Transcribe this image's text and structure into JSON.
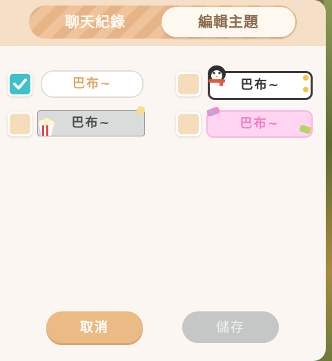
{
  "tabs": {
    "history": "聊天紀錄",
    "edit_theme": "編輯主題"
  },
  "themes": [
    {
      "label": "巴布~",
      "checked": true,
      "style": "plain-white"
    },
    {
      "label": "巴布~",
      "checked": false,
      "style": "penguin"
    },
    {
      "label": "巴布~",
      "checked": false,
      "style": "popcorn-ticket"
    },
    {
      "label": "巴布~",
      "checked": false,
      "style": "pink-candy"
    }
  ],
  "buttons": {
    "cancel": "取消",
    "save": "儲存"
  },
  "colors": {
    "accent": "#3ec1c8",
    "header": "#f5dfc6",
    "cancel": "#eabb84",
    "save_disabled": "#c5c7c6"
  }
}
